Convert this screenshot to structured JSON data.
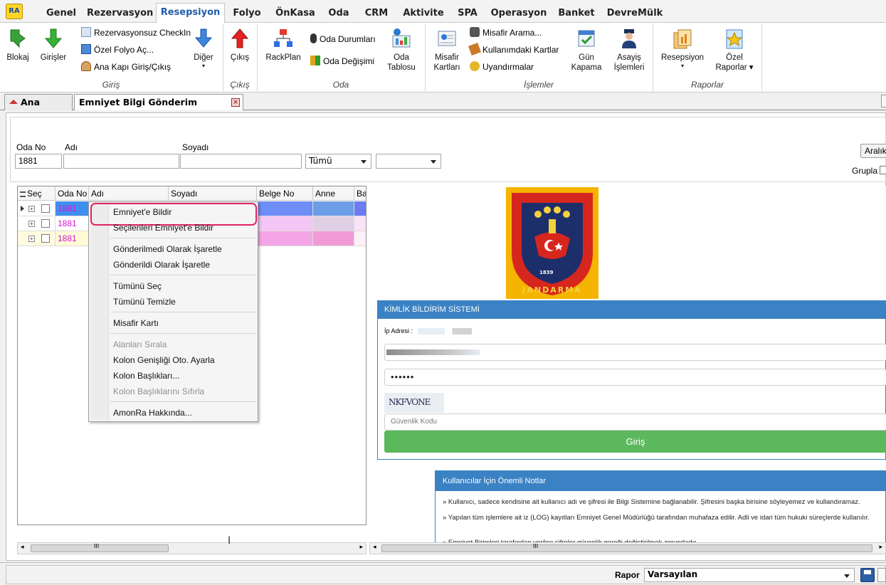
{
  "app_logo": "RA",
  "ribbon_tabs": [
    "Genel",
    "Rezervasyon",
    "Resepsiyon",
    "Folyo",
    "ÖnKasa",
    "Oda",
    "CRM",
    "Aktivite",
    "SPA",
    "Operasyon",
    "Banket",
    "DevreMülk"
  ],
  "ribbon": {
    "giris_group": {
      "label": "Giriş",
      "blokaj": "Blokaj",
      "girisler": "Girişler",
      "rez_checkin": "Rezervasyonsuz CheckIn",
      "ozel_folyo": "Özel Folyo Aç...",
      "ana_kapi": "Ana Kapı Giriş/Çıkış",
      "diger": "Diğer"
    },
    "cikis_group": {
      "label": "Çıkış",
      "cikis": "Çıkış"
    },
    "oda_group": {
      "label": "Oda",
      "rackplan": "RackPlan",
      "oda_durumlari": "Oda Durumları",
      "oda_degisimi": "Oda Değişimi",
      "oda_tablosu_1": "Oda",
      "oda_tablosu_2": "Tablosu"
    },
    "islemler_group": {
      "label": "İşlemler",
      "misafir_kartlari_1": "Misafir",
      "misafir_kartlari_2": "Kartları",
      "misafir_arama": "Misafir Arama...",
      "kullanimdaki_kartlar": "Kullanımdaki Kartlar",
      "uyandirmalar": "Uyandırmalar",
      "gun_kapama_1": "Gün",
      "gun_kapama_2": "Kapama",
      "asayis_1": "Asayiş",
      "asayis_2": "İşlemleri"
    },
    "raporlar_group": {
      "label": "Raporlar",
      "resepsiyon": "Resepsiyon",
      "ozel_raporlar_1": "Özel",
      "ozel_raporlar_2": "Raporlar"
    }
  },
  "doc_tabs": {
    "home": "Ana Ekran",
    "active": "Emniyet Bilgi Gönderim Detayları"
  },
  "filters": {
    "oda_no_label": "Oda No",
    "oda_no_value": "1881",
    "adi_label": "Adı",
    "soyadi_label": "Soyadı",
    "select1_value": "Tümü",
    "select2_value": "",
    "aralik_label": "Aralık",
    "grupla_label": "Grupla"
  },
  "grid": {
    "columns": [
      "Seç",
      "Oda No",
      "Adı",
      "Soyadı",
      "Belge No",
      "Anne",
      "Ba"
    ],
    "rows": [
      {
        "oda_no": "1881"
      },
      {
        "oda_no": "1881"
      },
      {
        "oda_no": "1881"
      }
    ],
    "scroll_marker": "III"
  },
  "context_menu": {
    "items": [
      {
        "label": "Emniyet'e Bildir",
        "enabled": true,
        "highlighted": true
      },
      {
        "label": "Seçilenleri Emniyet'e Bildir",
        "enabled": true
      },
      {
        "label": "Gönderilmedi Olarak İşaretle",
        "enabled": true
      },
      {
        "label": "Gönderildi Olarak İşaretle",
        "enabled": true
      },
      {
        "label": "Tümünü Seç",
        "enabled": true
      },
      {
        "label": "Tümünü Temizle",
        "enabled": true
      },
      {
        "label": "Misafir Kartı",
        "enabled": true
      },
      {
        "label": "Alanları Sırala",
        "enabled": false
      },
      {
        "label": "Kolon Genişliği Oto. Ayarla",
        "enabled": true
      },
      {
        "label": "Kolon Başlıkları...",
        "enabled": true
      },
      {
        "label": "Kolon Başlıklarını Sıfırla",
        "enabled": false
      },
      {
        "label": "AmonRa Hakkında...",
        "enabled": true
      }
    ]
  },
  "jandarma": {
    "emblem_text": "JANDARMA",
    "year": "1839",
    "panel_title": "KİMLİK BİLDİRİM SİSTEMİ",
    "ip_label": "İp Adresi :",
    "password_mask": "••••••",
    "captcha_text": "NKFVONE",
    "security_code_placeholder": "Güvenlik Kodu",
    "login_button": "Giriş",
    "notes_title": "Kullanıcılar İçin Önemli Notlar",
    "notes": [
      "» Kullanıcı, sadece kendisine ait kullanıcı adı ve şifresi ile Bilgi Sistemine bağlanabilir. Şifresini başka birisine söyleyemez ve kullandıramaz.",
      "» Yapılan tüm işlemlere ait iz (LOG) kayıtları Emniyet Genel Müdürlüğü tarafından muhafaza edilir. Adli ve idari tüm hukuki süreçlerde kullanılır.",
      "» Emniyet Birimleri tarafından verilen şifreler güvenlik gereği değiştirilmek zorundadır."
    ]
  },
  "statusbar": {
    "rapor_label": "Rapor",
    "rapor_value": "Varsayılan"
  },
  "colors": {
    "accent": "#1f5ea8",
    "panel_blue": "#3b82c4",
    "login_green": "#5cb85c",
    "highlight_red": "#e0245e",
    "row_text": "#d21bd2"
  }
}
